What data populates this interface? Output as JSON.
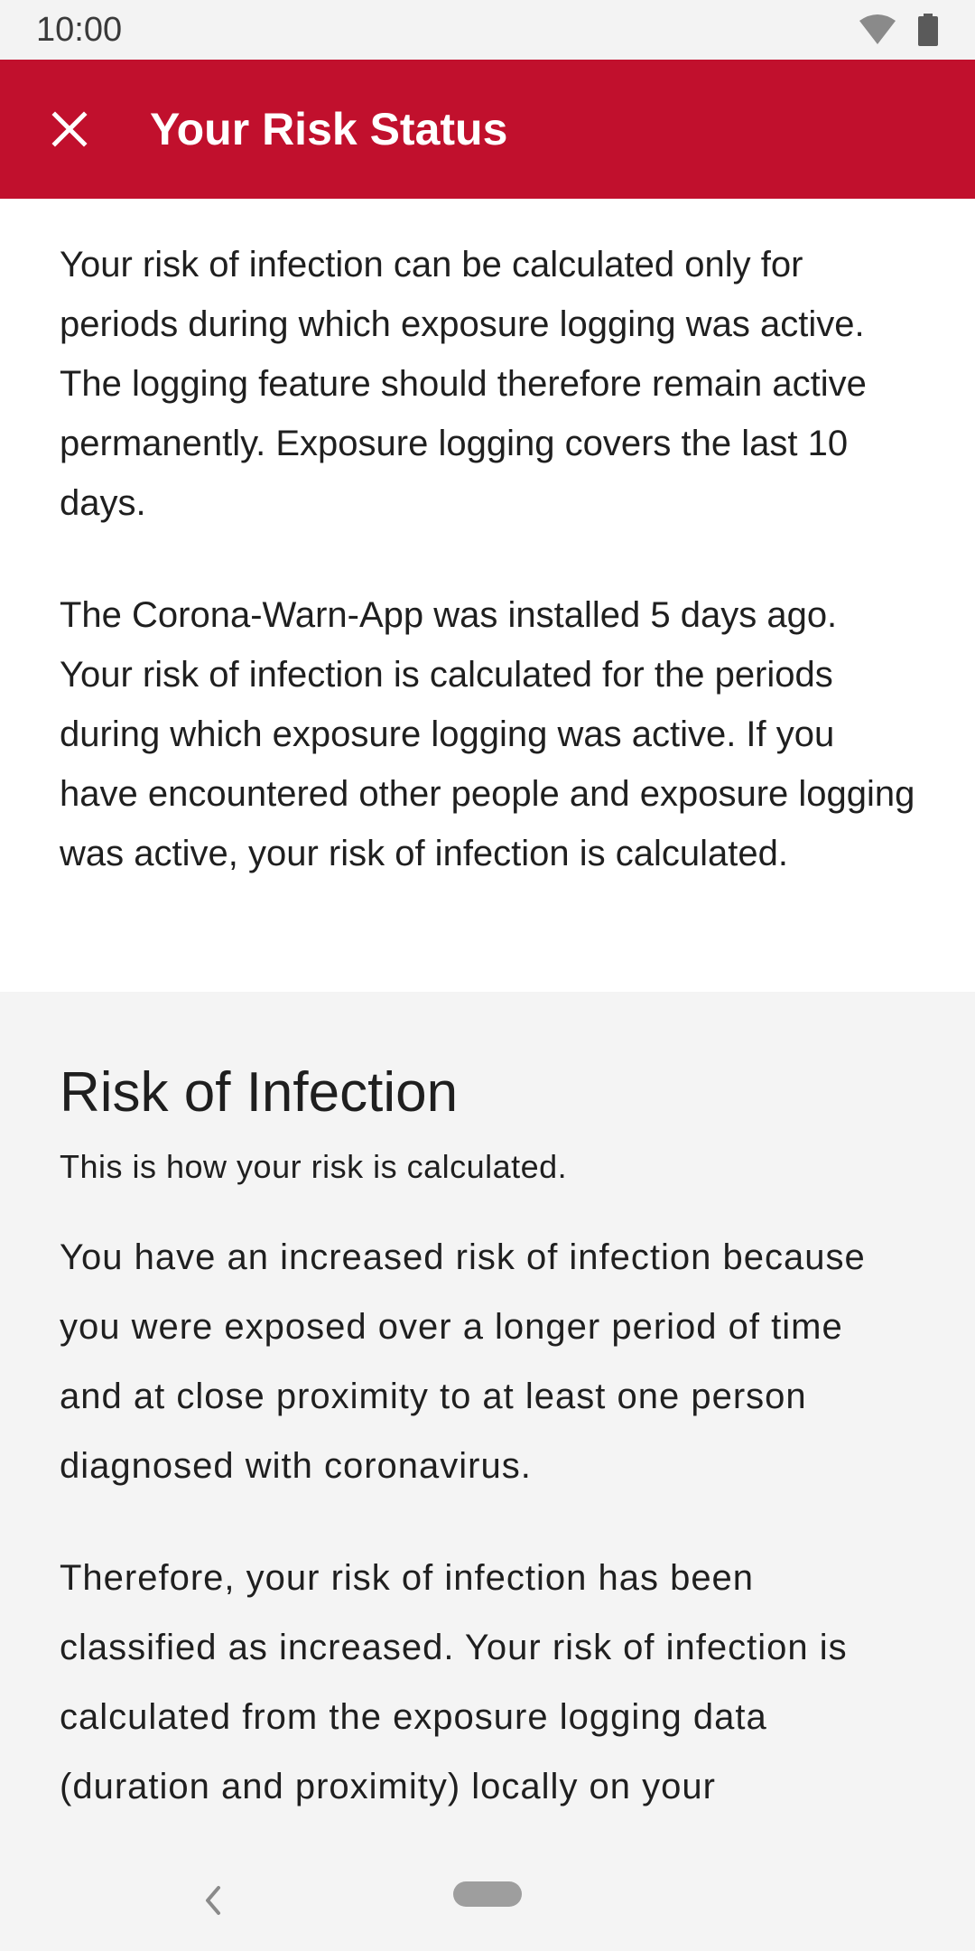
{
  "status_bar": {
    "time": "10:00",
    "icons": [
      "wifi-icon",
      "battery-icon"
    ]
  },
  "app_bar": {
    "title": "Your Risk Status",
    "close_icon": "close-icon",
    "color": "#c1102d"
  },
  "intro": {
    "paragraphs": [
      "Your risk of infection can be calculated only for periods during which exposure logging was active. The logging feature should therefore remain active permanently. Exposure logging covers the last 10 days.",
      "The Corona-Warn-App was installed 5 days ago. Your risk of infection is calculated for the periods during which exposure logging was active. If you have encountered other people and exposure logging was active, your risk of infection is calculated."
    ]
  },
  "risk_section": {
    "title": "Risk of Infection",
    "subtitle": "This is how your risk is calculated.",
    "paragraphs": [
      "You have an increased risk of infection because you were exposed over a longer period of time and at close proximity to at least one person diagnosed with coronavirus.",
      "Therefore, your risk of infection has been classified as increased. Your risk of infection is calculated from the exposure logging data (duration and proximity) locally on your"
    ]
  },
  "nav_bar": {
    "back_icon": "back-chevron-icon",
    "home_icon": "home-pill-icon"
  }
}
